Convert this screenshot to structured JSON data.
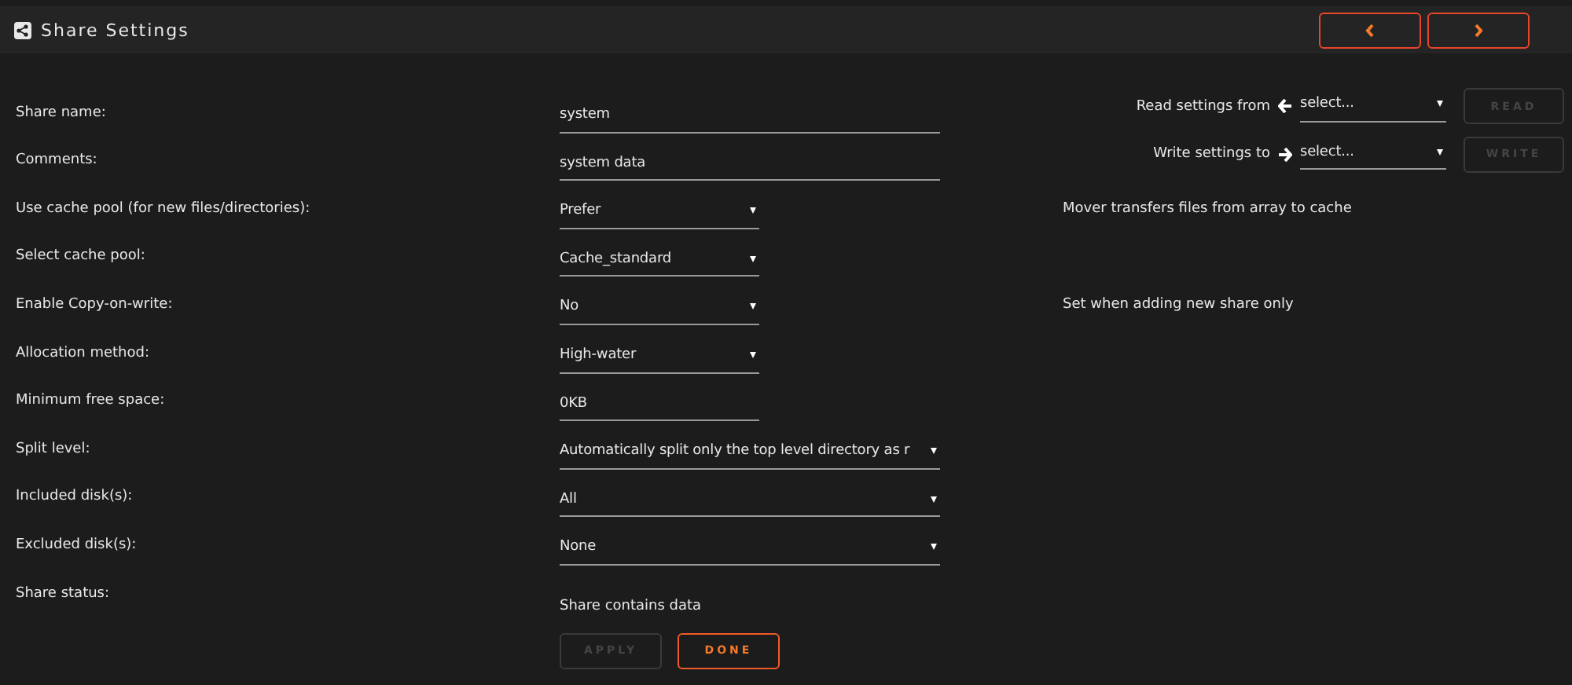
{
  "header": {
    "title": "Share Settings"
  },
  "rows": [
    {
      "label": "Share name:",
      "kind": "text",
      "value": "system"
    },
    {
      "label": "Comments:",
      "kind": "text",
      "value": "system data"
    },
    {
      "label": "Use cache pool (for new files/directories):",
      "kind": "select",
      "value": "Prefer",
      "note": "Mover transfers files from array to cache"
    },
    {
      "label": "Select cache pool:",
      "kind": "select",
      "value": "Cache_standard"
    },
    {
      "label": "Enable Copy-on-write:",
      "kind": "select",
      "value": "No",
      "note": "Set when adding new share only"
    },
    {
      "label": "Allocation method:",
      "kind": "select",
      "value": "High-water"
    },
    {
      "label": "Minimum free space:",
      "kind": "text",
      "value": "0KB"
    },
    {
      "label": "Split level:",
      "kind": "select",
      "value": "Automatically split only the top level directory as r"
    },
    {
      "label": "Included disk(s):",
      "kind": "select",
      "value": "All"
    },
    {
      "label": "Excluded disk(s):",
      "kind": "select",
      "value": "None"
    },
    {
      "label": "Share status:",
      "kind": "static",
      "value": "Share contains data"
    }
  ],
  "read": {
    "label": "Read settings from",
    "value": "select...",
    "button": "READ",
    "disabled": true
  },
  "write": {
    "label": "Write settings to",
    "value": "select...",
    "button": "WRITE",
    "disabled": true
  },
  "actions": [
    {
      "label": "APPLY",
      "disabled": true
    },
    {
      "label": "DONE",
      "disabled": false
    }
  ]
}
